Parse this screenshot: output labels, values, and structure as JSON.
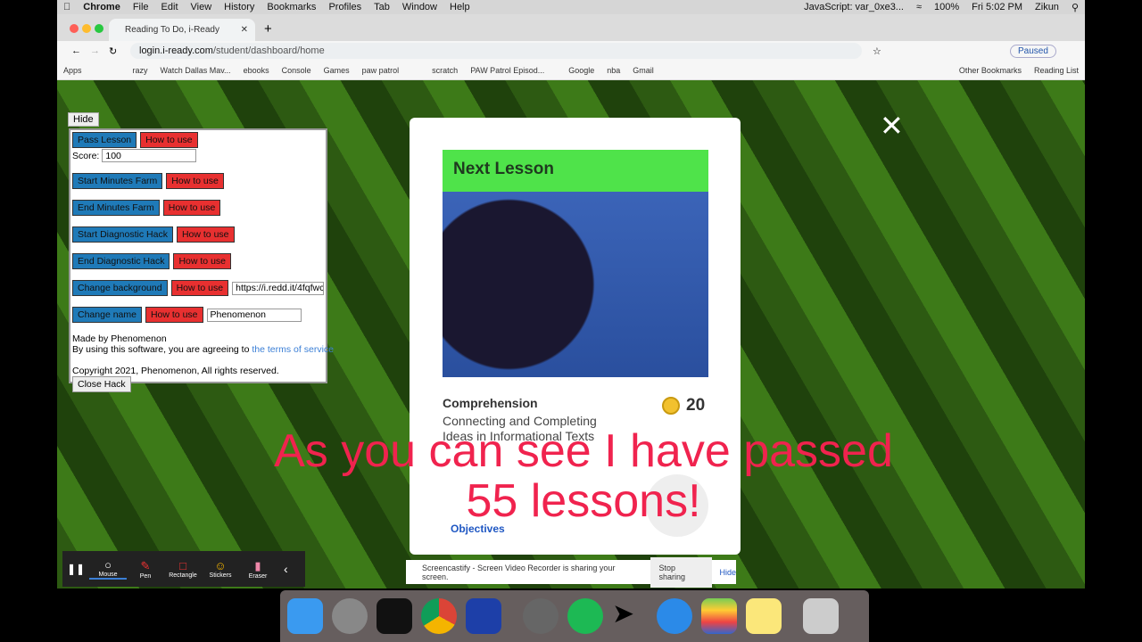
{
  "menubar": {
    "app": "Chrome",
    "items": [
      "File",
      "Edit",
      "View",
      "History",
      "Bookmarks",
      "Profiles",
      "Tab",
      "Window",
      "Help"
    ],
    "status": "JavaScript: var_0xe3...",
    "battery": "100%",
    "clock": "Fri 5:02 PM",
    "user": "Zikun"
  },
  "browser": {
    "tab_title": "Reading To Do, i-Ready",
    "url_host": "login.i-ready.com",
    "url_path": "/student/dashboard/home",
    "profile": "Paused",
    "bookmarks": [
      "Apps",
      "razy",
      "Watch Dallas Mav...",
      "ebooks",
      "Console",
      "Games",
      "paw patrol",
      "scratch",
      "PAW Patrol Episod...",
      "Google",
      "nba",
      "Gmail"
    ],
    "other_bookmarks": "Other Bookmarks",
    "reading_list": "Reading List"
  },
  "hack": {
    "hide": "Hide",
    "pass": "Pass Lesson",
    "howto": "How to use",
    "score_label": "Score:",
    "score": "100",
    "start_farm": "Start Minutes Farm",
    "end_farm": "End Minutes Farm",
    "start_diag": "Start Diagnostic Hack",
    "end_diag": "End Diagnostic Hack",
    "change_bg": "Change background",
    "bg_url": "https://i.redd.it/4fqfwc",
    "change_name": "Change name",
    "name": "Phenomenon",
    "made_by": "Made by Phenomenon",
    "agree": "By using this software, you are agreeing to ",
    "terms": "the terms of service",
    "copyright": "Copyright 2021, Phenomenon, All rights reserved.",
    "close": "Close Hack"
  },
  "lesson": {
    "header": "Next Lesson",
    "category": "Comprehension",
    "title": "Connecting and Completing Ideas in Informational Texts",
    "coins": "20",
    "objectives": "Objectives"
  },
  "overlay": {
    "line1": "As you can see I have passed",
    "line2": "55 lessons!"
  },
  "screencastify": {
    "message": "Screencastify - Screen Video Recorder is sharing your screen.",
    "stop": "Stop sharing",
    "hide": "Hide"
  },
  "tools": [
    "Mouse",
    "Pen",
    "Rectangle",
    "Stickers",
    "Eraser"
  ]
}
